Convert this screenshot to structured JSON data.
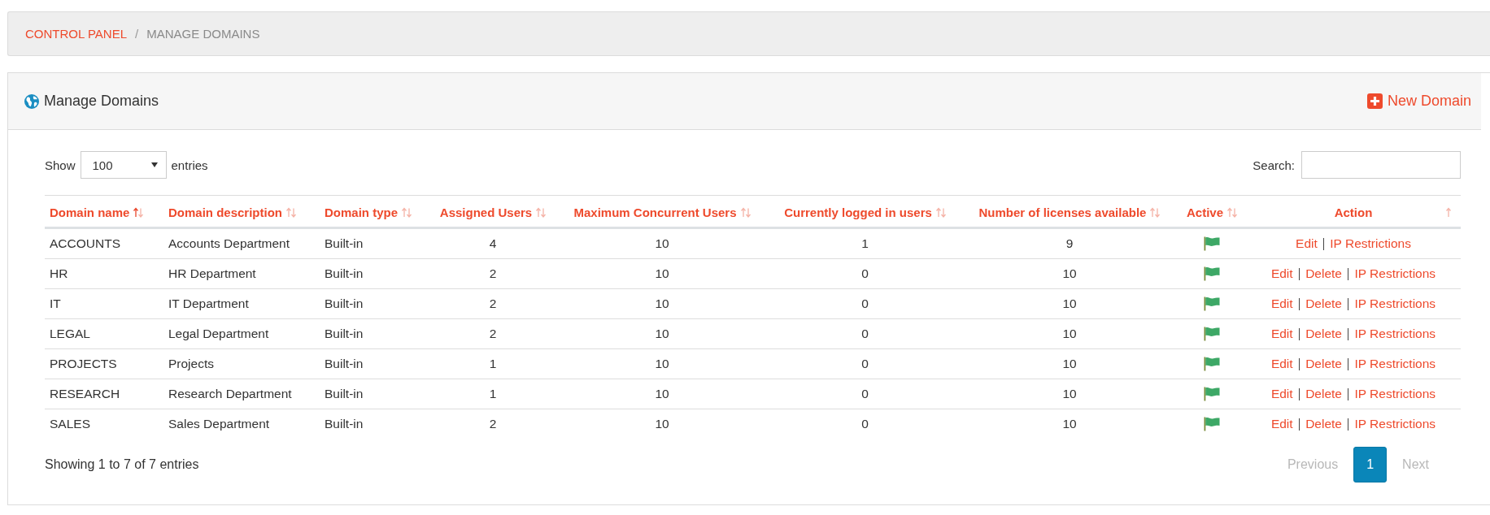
{
  "breadcrumb": {
    "separator": "/",
    "items": [
      {
        "label": "CONTROL PANEL",
        "link": true
      },
      {
        "label": "MANAGE DOMAINS",
        "link": false
      }
    ]
  },
  "panel": {
    "title": "Manage Domains",
    "new_button": "New Domain"
  },
  "length_menu": {
    "before": "Show",
    "value": "100",
    "after": "entries"
  },
  "search": {
    "label": "Search:"
  },
  "table": {
    "columns": [
      {
        "label": "Domain name",
        "sortable": true,
        "sorted": true
      },
      {
        "label": "Domain description",
        "sortable": true,
        "sorted": false
      },
      {
        "label": "Domain type",
        "sortable": true,
        "sorted": false
      },
      {
        "label": "Assigned Users",
        "sortable": true,
        "sorted": false
      },
      {
        "label": "Maximum Concurrent Users",
        "sortable": true,
        "sorted": false
      },
      {
        "label": "Currently logged in users",
        "sortable": true,
        "sorted": false
      },
      {
        "label": "Number of licenses available",
        "sortable": true,
        "sorted": false
      },
      {
        "label": "Active",
        "sortable": true,
        "sorted": false
      },
      {
        "label": "Action",
        "sortable": false,
        "sorted": false
      }
    ],
    "rows": [
      {
        "cells": [
          "ACCOUNTS",
          "Accounts Department",
          "Built-in",
          "4",
          "10",
          "1",
          "9"
        ],
        "active": true,
        "actions": [
          "Edit",
          "IP Restrictions"
        ]
      },
      {
        "cells": [
          "HR",
          "HR Department",
          "Built-in",
          "2",
          "10",
          "0",
          "10"
        ],
        "active": true,
        "actions": [
          "Edit",
          "Delete",
          "IP Restrictions"
        ]
      },
      {
        "cells": [
          "IT",
          "IT Department",
          "Built-in",
          "2",
          "10",
          "0",
          "10"
        ],
        "active": true,
        "actions": [
          "Edit",
          "Delete",
          "IP Restrictions"
        ]
      },
      {
        "cells": [
          "LEGAL",
          "Legal Department",
          "Built-in",
          "2",
          "10",
          "0",
          "10"
        ],
        "active": true,
        "actions": [
          "Edit",
          "Delete",
          "IP Restrictions"
        ]
      },
      {
        "cells": [
          "PROJECTS",
          "Projects",
          "Built-in",
          "1",
          "10",
          "0",
          "10"
        ],
        "active": true,
        "actions": [
          "Edit",
          "Delete",
          "IP Restrictions"
        ]
      },
      {
        "cells": [
          "RESEARCH",
          "Research Department",
          "Built-in",
          "1",
          "10",
          "0",
          "10"
        ],
        "active": true,
        "actions": [
          "Edit",
          "Delete",
          "IP Restrictions"
        ]
      },
      {
        "cells": [
          "SALES",
          "Sales Department",
          "Built-in",
          "2",
          "10",
          "0",
          "10"
        ],
        "active": true,
        "actions": [
          "Edit",
          "Delete",
          "IP Restrictions"
        ]
      }
    ]
  },
  "info": "Showing 1 to 7 of 7 entries",
  "pagination": {
    "previous": {
      "label": "Previous",
      "disabled": true
    },
    "pages": [
      {
        "label": "1",
        "selected": true
      }
    ],
    "next": {
      "label": "Next",
      "disabled": true
    }
  }
}
